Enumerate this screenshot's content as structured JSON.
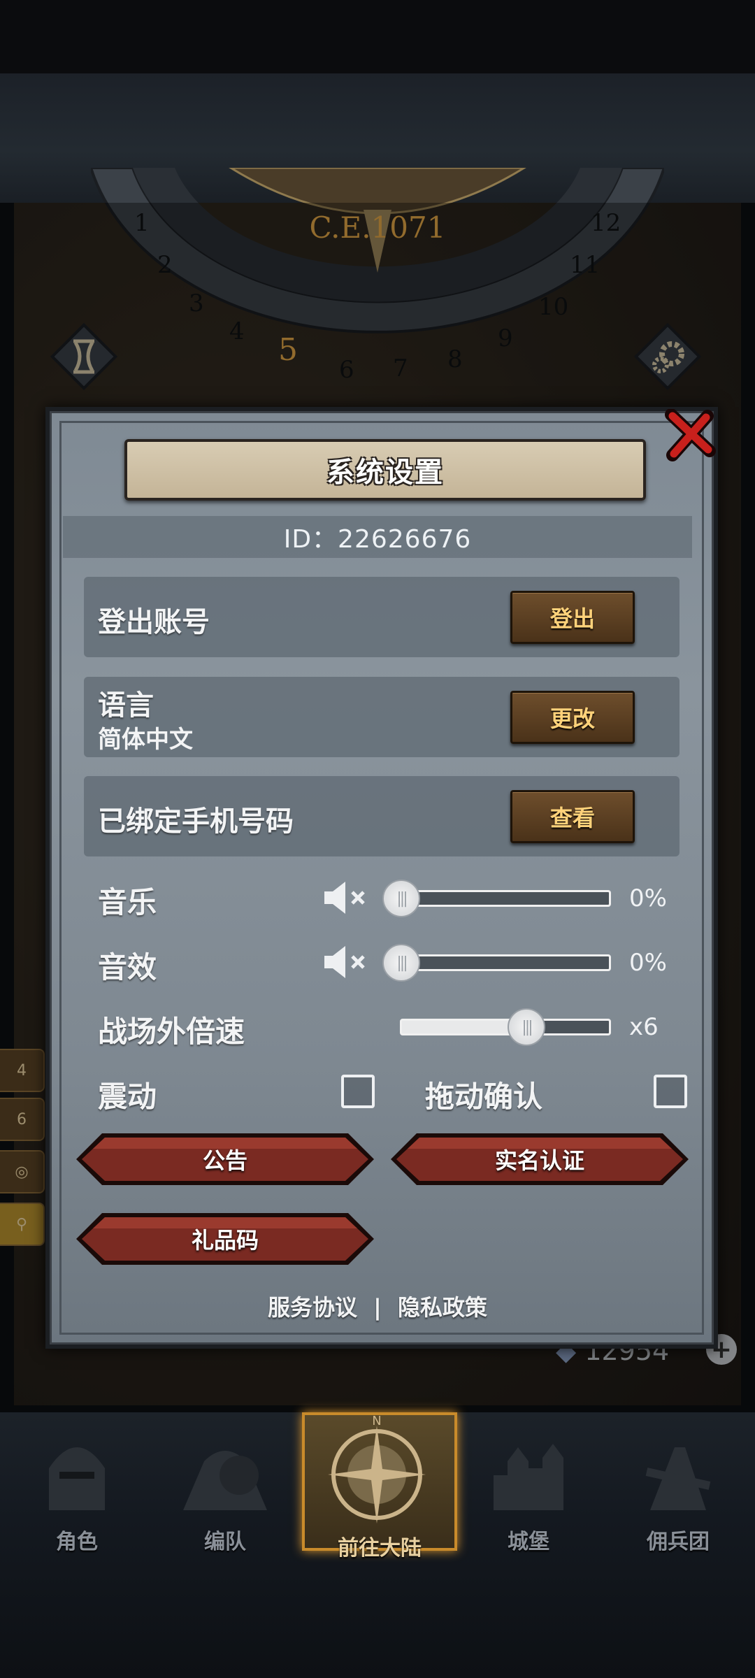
{
  "dial": {
    "era": "C.E.1071",
    "months": [
      "1",
      "2",
      "3",
      "4",
      "5",
      "6",
      "7",
      "8",
      "9",
      "10",
      "11",
      "12"
    ],
    "current_month": "5"
  },
  "side_tabs": [
    "4",
    "6"
  ],
  "dialog": {
    "title": "系统设置",
    "id_text": "ID：22626676",
    "rows": [
      {
        "label": "登出账号",
        "button": "登出"
      },
      {
        "label": "语言",
        "sub": "简体中文",
        "button": "更改"
      },
      {
        "label": "已绑定手机号码",
        "button": "查看"
      }
    ],
    "music": {
      "label": "音乐",
      "value": "0%",
      "level": 0
    },
    "sfx": {
      "label": "音效",
      "value": "0%",
      "level": 0
    },
    "speed": {
      "label": "战场外倍速",
      "value": "x6",
      "level": 0.6
    },
    "vibration": {
      "label": "震动",
      "checked": false
    },
    "drag_confirm": {
      "label": "拖动确认",
      "checked": false
    },
    "buttons": {
      "notice": "公告",
      "realname": "实名认证",
      "gift": "礼品码"
    },
    "links": {
      "service": "服务协议",
      "separator": "|",
      "privacy": "隐私政策"
    }
  },
  "currency": {
    "value": "12954"
  },
  "nav": [
    {
      "label": "角色",
      "icon": "knight-helmet-icon"
    },
    {
      "label": "编队",
      "icon": "team-icon"
    },
    {
      "label": "前往大陆",
      "icon": "compass-icon",
      "active": true
    },
    {
      "label": "城堡",
      "icon": "castle-icon"
    },
    {
      "label": "佣兵团",
      "icon": "mercenary-icon"
    }
  ],
  "colors": {
    "accent_gold": "#ffd27a",
    "active_border": "#c98b2b",
    "red_button": "#7a2a22"
  }
}
